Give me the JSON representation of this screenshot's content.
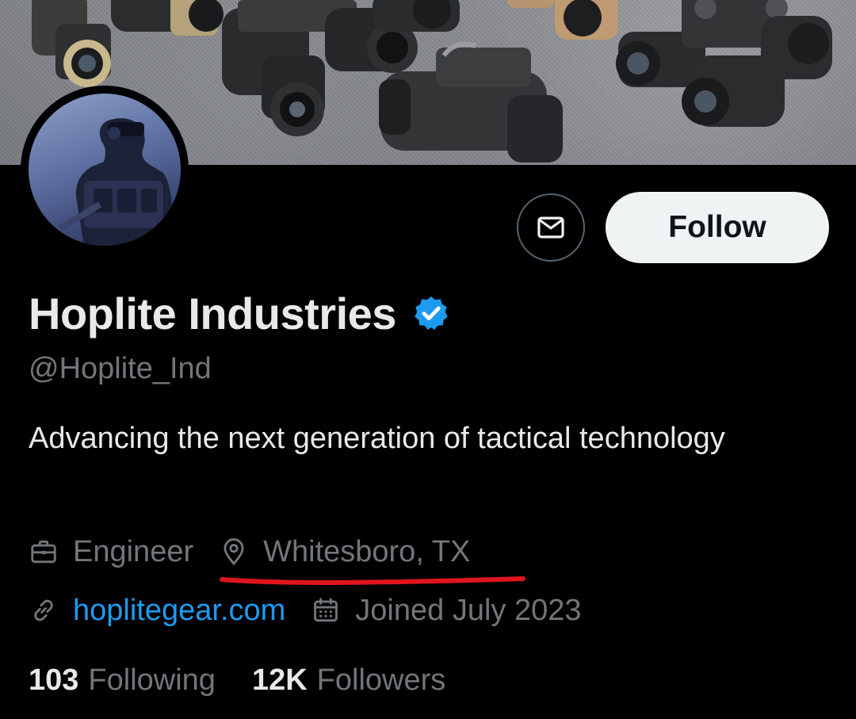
{
  "profile": {
    "display_name": "Hoplite Industries",
    "handle": "@Hoplite_Ind",
    "bio": "Advancing the next generation of tactical technology",
    "profession": "Engineer",
    "location": "Whitesboro, TX",
    "website": "hoplitegear.com",
    "joined": "Joined July 2023",
    "verified": true
  },
  "actions": {
    "follow_label": "Follow"
  },
  "stats": {
    "following_count": "103",
    "following_label": "Following",
    "followers_count": "12K",
    "followers_label": "Followers"
  },
  "icons": {
    "message": "envelope-icon",
    "verified": "verified-badge-icon",
    "profession": "briefcase-icon",
    "location": "location-pin-icon",
    "website": "link-icon",
    "joined": "calendar-icon"
  },
  "colors": {
    "background": "#000000",
    "primary_text": "#e7e9ea",
    "secondary_text": "#71767b",
    "link": "#1d9bf0",
    "verified": "#1d9bf0",
    "follow_button_bg": "#eff3f4",
    "annotation_underline": "#e0141c"
  }
}
